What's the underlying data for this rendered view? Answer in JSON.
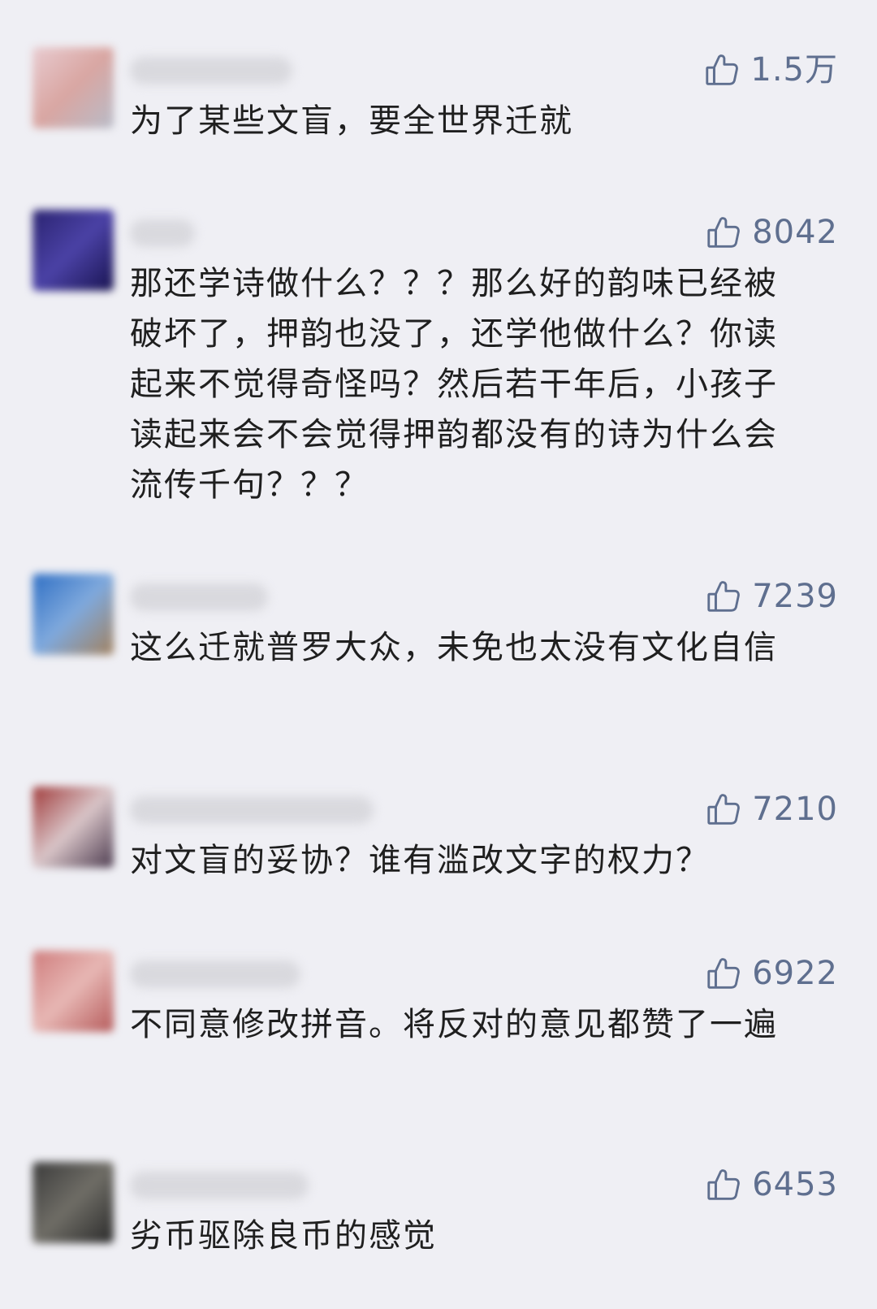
{
  "comments": [
    {
      "nickname": "",
      "likes": "1.5万",
      "text": "为了某些文盲，要全世界迁就",
      "avatar_colors": [
        "#e8cbd0",
        "#d9a6a2",
        "#b8bcc8"
      ]
    },
    {
      "nickname": "",
      "likes": "8042",
      "text": "那还学诗做什么？？？那么好的韵味已经被破坏了，押韵也没了，还学他做什么？你读起来不觉得奇怪吗？然后若干年后，小孩子读起来会不会觉得押韵都没有的诗为什么会流传千句？？？",
      "avatar_colors": [
        "#2a2370",
        "#4b42a6",
        "#181350"
      ]
    },
    {
      "nickname": "",
      "likes": "7239",
      "text": "这么迁就普罗大众，未免也太没有文化自信",
      "avatar_colors": [
        "#2f6fc4",
        "#7fa9dd",
        "#a2815e"
      ]
    },
    {
      "nickname": "",
      "likes": "7210",
      "text": "对文盲的妥协？谁有滥改文字的权力？",
      "avatar_colors": [
        "#a03a3a",
        "#d9c5c8",
        "#4c3b4f"
      ]
    },
    {
      "nickname": "",
      "likes": "6922",
      "text": "不同意修改拼音。将反对的意见都赞了一遍",
      "avatar_colors": [
        "#cf7d7d",
        "#e7b7b4",
        "#b55a5a"
      ]
    },
    {
      "nickname": "",
      "likes": "6453",
      "text": "劣币驱除良币的感觉",
      "avatar_colors": [
        "#3b3b3b",
        "#6f6d66",
        "#2a2a2a"
      ]
    }
  ]
}
